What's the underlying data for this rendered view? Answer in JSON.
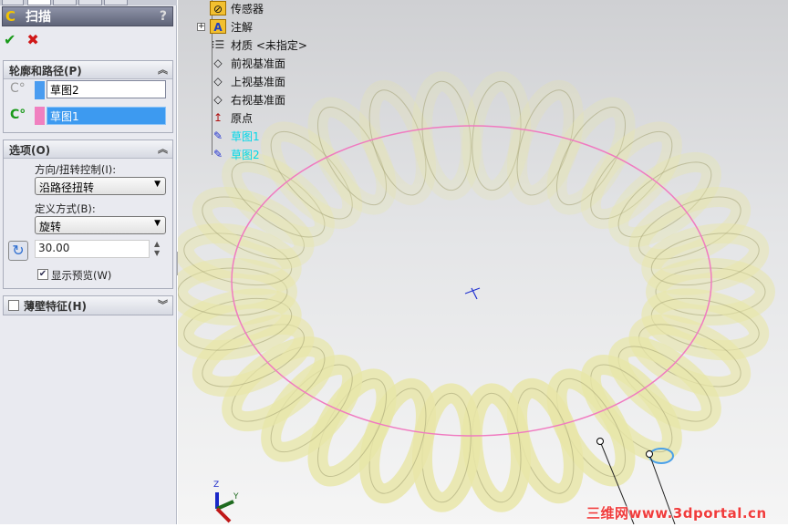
{
  "feature": {
    "title": "扫描",
    "help": "?",
    "ok_icon": "checkmark-icon",
    "cancel_icon": "x-icon"
  },
  "profile_path": {
    "header": "轮廓和路径(P)",
    "profile_value": "草图2",
    "path_value": "草图1",
    "profile_color": "#4a9cf0",
    "path_color": "#f080c0"
  },
  "options": {
    "header": "选项(O)",
    "orientation_label": "方向/扭转控制(I):",
    "orientation_value": "沿路径扭转",
    "define_label": "定义方式(B):",
    "define_value": "旋转",
    "angle_value": "30.00",
    "preview_label": "显示预览(W)",
    "preview_checked": true
  },
  "thin_feature": {
    "header": "薄壁特征(H)",
    "checked": false
  },
  "tree": {
    "items": [
      {
        "label": "传感器"
      },
      {
        "label": "注解"
      },
      {
        "label": "材质 <未指定>"
      },
      {
        "label": "前视基准面"
      },
      {
        "label": "上视基准面"
      },
      {
        "label": "右视基准面"
      },
      {
        "label": "原点"
      },
      {
        "label": "草图1"
      },
      {
        "label": "草图2"
      }
    ]
  },
  "triad": {
    "z": "Z",
    "y": "Y"
  },
  "watermark": "三维网www.3dportal.cn",
  "colors": {
    "coil": "#e8e6a8",
    "path": "#f07ac0",
    "sketch_text": "#00d8e8"
  }
}
